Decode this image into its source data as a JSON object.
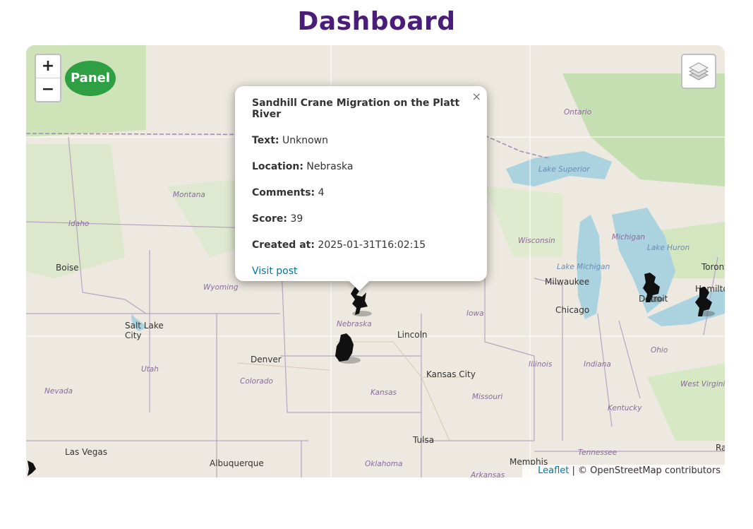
{
  "header": {
    "title": "Dashboard"
  },
  "map": {
    "zoom_in_label": "+",
    "zoom_out_label": "−",
    "panel_button_label": "Panel",
    "layers_icon": "layers-icon",
    "attribution": {
      "leaflet": "Leaflet",
      "separator": " | ",
      "osm": "© OpenStreetMap contributors"
    },
    "city_labels": [
      "Boise",
      "Salt Lake City",
      "Denver",
      "Las Vegas",
      "Albuquerque",
      "Lincoln",
      "Kansas City",
      "Tulsa",
      "Memphis",
      "Milwaukee",
      "Chicago",
      "Detroit",
      "Toronto",
      "Hamilton",
      "Ra"
    ],
    "state_labels": [
      "Montana",
      "Idaho",
      "Wyoming",
      "Nevada",
      "Utah",
      "Colorado",
      "Nebraska",
      "Kansas",
      "Iowa",
      "Missouri",
      "Illinois",
      "Indiana",
      "Ohio",
      "Oklahoma",
      "Arkansas",
      "Tennessee",
      "Kentucky",
      "West Virginia",
      "Wisconsin",
      "Michigan",
      "Ontario"
    ],
    "water_labels": [
      "Lake Superior",
      "Lake Michigan",
      "Lake Huron"
    ]
  },
  "popup": {
    "title": "Sandhill Crane Migration on the Platt River",
    "close_label": "×",
    "fields": [
      {
        "label": "Text:",
        "value": "Unknown"
      },
      {
        "label": "Location:",
        "value": "Nebraska"
      },
      {
        "label": "Comments:",
        "value": "4"
      },
      {
        "label": "Score:",
        "value": "39"
      },
      {
        "label": "Created at:",
        "value": "2025-01-31T16:02:15"
      }
    ],
    "link_label": "Visit post"
  },
  "colors": {
    "title": "#4a1d78",
    "panel": "#2ea043",
    "link": "#0078a8"
  }
}
